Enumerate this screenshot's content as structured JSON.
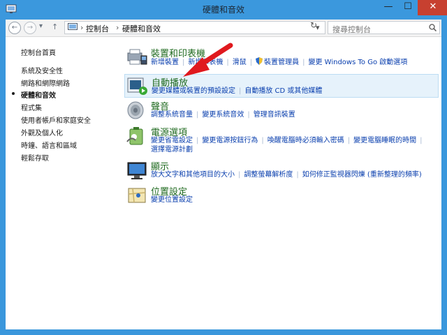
{
  "window": {
    "title": "硬體和音效",
    "min_label": "—",
    "max_label": "☐",
    "close_label": "✕"
  },
  "nav": {
    "back_label": "←",
    "forward_label": "→",
    "dropdown_label": "▾",
    "up_label": "↑",
    "breadcrumb": [
      "控制台",
      "硬體和音效"
    ],
    "breadcrumb_sep": "›",
    "refresh_label": "↻",
    "search_placeholder": "搜尋控制台",
    "search_icon": "search-icon"
  },
  "sidebar": {
    "items": [
      {
        "label": "控制台首頁",
        "current": false
      },
      {
        "label": "系統及安全性",
        "current": false
      },
      {
        "label": "網路和網際網路",
        "current": false
      },
      {
        "label": "硬體和音效",
        "current": true
      },
      {
        "label": "程式集",
        "current": false
      },
      {
        "label": "使用者帳戶和家庭安全",
        "current": false
      },
      {
        "label": "外觀及個人化",
        "current": false
      },
      {
        "label": "時鐘、語言和區域",
        "current": false
      },
      {
        "label": "輕鬆存取",
        "current": false
      }
    ]
  },
  "categories": [
    {
      "title": "裝置和印表機",
      "icon": "devices-printers-icon",
      "links": [
        "新增裝置",
        "新增印表機",
        "滑鼠",
        "裝置管理員",
        "變更 Windows To Go 啟動選項"
      ],
      "highlight": false
    },
    {
      "title": "自動播放",
      "icon": "autoplay-icon",
      "links": [
        "變更媒體或裝置的預設設定",
        "自動播放 CD 或其他媒體"
      ],
      "highlight": true
    },
    {
      "title": "聲音",
      "icon": "speaker-icon",
      "links": [
        "調整系統音量",
        "變更系統音效",
        "管理音訊裝置"
      ],
      "highlight": false
    },
    {
      "title": "電源選項",
      "icon": "power-options-icon",
      "links": [
        "變更省電設定",
        "變更電源按鈕行為",
        "喚醒電腦時必須輸入密碼",
        "變更電腦睡眠的時間",
        "選擇電源計劃"
      ],
      "highlight": false
    },
    {
      "title": "顯示",
      "icon": "display-icon",
      "links": [
        "放大文字和其他項目的大小",
        "調整螢幕解析度",
        "如何修正監視器閃爍 (重新整理的頻率)"
      ],
      "highlight": false
    },
    {
      "title": "位置設定",
      "icon": "location-settings-icon",
      "links": [
        "變更位置設定"
      ],
      "highlight": false
    }
  ],
  "colors": {
    "accent_title": "#3b98dd",
    "close_red": "#c74030",
    "link_blue": "#0a3fae",
    "category_green": "#1f6a1f",
    "annotation_red": "#e0191e"
  }
}
